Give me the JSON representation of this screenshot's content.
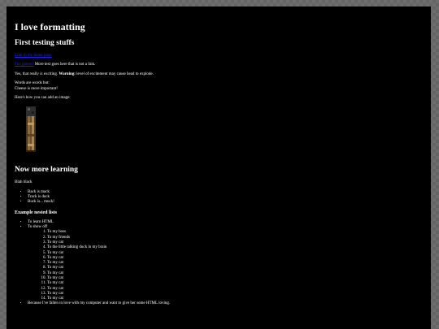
{
  "title": "I love formatting",
  "sections": {
    "first_heading": "First testing stuffs",
    "link_line": "Link to my home page",
    "link_inline": "Fun games!",
    "link_inline_after": " More text goes here that is not a link.",
    "excite_before": "Yes, that really ",
    "excite_is": "is",
    "excite_mid": " exciting. ",
    "excite_warning": "Warning:",
    "excite_after": " level of excitement may cause head to explode.",
    "words_line1": "Words are words but:",
    "words_line2": "Cheese is more important!",
    "image_intro": "Here's how you can add an image:",
    "second_heading": "Now more learning",
    "blah": "Blah black",
    "simple_list": [
      "Back is mack",
      "Track is duck",
      "Buck is... muck!"
    ],
    "nested_heading": "Example nested lists",
    "outer_list": {
      "item1": "To learn HTML",
      "item2": "To show off",
      "inner": [
        "To my boss",
        "To my friends",
        "To my cat",
        "To the little talking duck in my brain",
        "To my cat",
        "To my cat",
        "To my cat",
        "To my cat",
        "To my cat",
        "To my cat",
        "To my cat",
        "To my cat",
        "To my cat",
        "To my cat"
      ],
      "item3": "Because I've fallen in love with my computer and want to give her some HTML loving."
    }
  },
  "colors": {
    "background": "#000000",
    "text": "#ffffff",
    "link": "#2323e6",
    "torch_wood": "#8a6a3c",
    "torch_head": "#3a3a3a"
  },
  "icons": {
    "image": "torch-pixel-image"
  }
}
